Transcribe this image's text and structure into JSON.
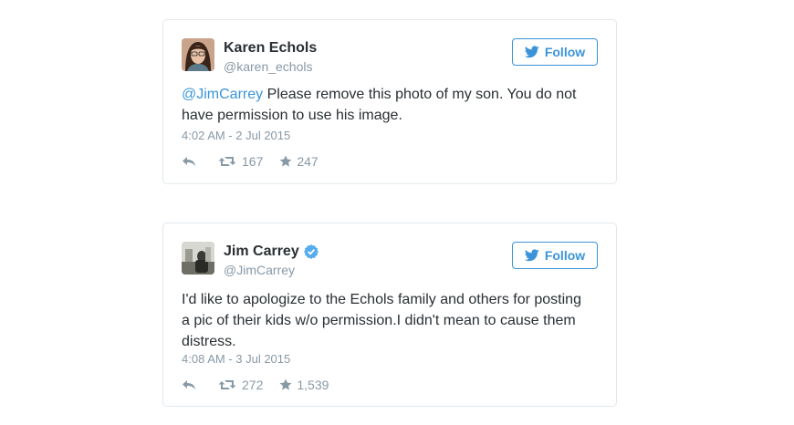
{
  "colors": {
    "accent": "#3b94d9",
    "text": "#292f33",
    "muted": "#8899a6",
    "border": "#e1e8ed"
  },
  "tweets": [
    {
      "name": "Karen Echols",
      "handle": "@karen_echols",
      "verified": false,
      "follow_label": "Follow",
      "mention": "@JimCarrey",
      "text": " Please remove this photo of my son.  You do not have permission to use his image.",
      "time": "4:02 AM - 2 Jul 2015",
      "retweets": "167",
      "favorites": "247"
    },
    {
      "name": "Jim Carrey",
      "handle": "@JimCarrey",
      "verified": true,
      "follow_label": "Follow",
      "text": "I'd like to apologize to the Echols family and others for posting a pic of their kids w/o permission.I didn't mean to cause them distress.",
      "time": "4:08 AM - 3 Jul 2015",
      "retweets": "272",
      "favorites": "1,539"
    }
  ]
}
